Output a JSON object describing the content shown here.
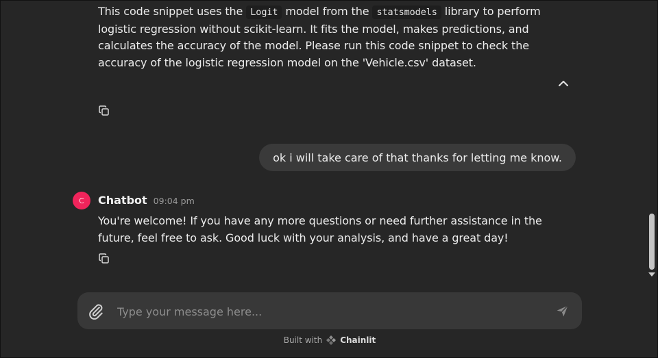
{
  "assistant_message_1": {
    "parts": [
      "This code snippet uses the ",
      "Logit",
      " model from the ",
      "statsmodels",
      " library to perform logistic regression without scikit-learn. It fits the model, makes predictions, and calculates the accuracy of the model. Please run this code snippet to check the accuracy of the logistic regression model on the 'Vehicle.csv' dataset."
    ]
  },
  "user_message": {
    "text": "ok i will take care of that thanks for letting me know."
  },
  "assistant_message_2": {
    "avatar_letter": "C",
    "author": "Chatbot",
    "time": "09:04 pm",
    "text": "You're welcome! If you have any more questions or need further assistance in the future, feel free to ask. Good luck with your analysis, and have a great day!"
  },
  "composer": {
    "placeholder": "Type your message here..."
  },
  "footer": {
    "built_with": "Built with",
    "brand": "Chainlit"
  },
  "icons": {
    "collapse": "chevron-up-icon",
    "copy": "copy-icon",
    "attach": "paperclip-icon",
    "send": "send-icon",
    "brand": "chainlit-logo-icon"
  },
  "colors": {
    "background": "#262626",
    "bubble": "#3a3a3a",
    "composer": "#383838",
    "avatar": "#f0245b"
  }
}
